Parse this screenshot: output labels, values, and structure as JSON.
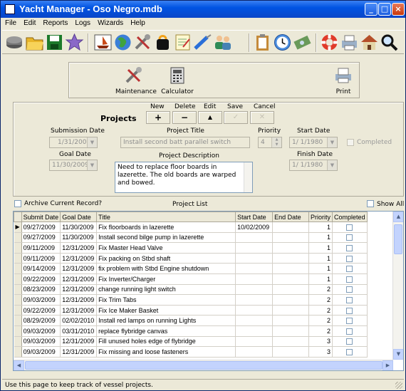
{
  "window": {
    "title": "Yacht Manager - Oso Negro.mdb"
  },
  "menu": [
    "File",
    "Edit",
    "Reports",
    "Logs",
    "Wizards",
    "Help"
  ],
  "toolbar": [
    "disk-icon",
    "folder-icon",
    "save-icon",
    "star-icon",
    "boat-icon",
    "globe-icon",
    "tools-icon",
    "bag-icon",
    "notepad-icon",
    "drill-icon",
    "people-icon",
    "clipboard-icon",
    "clock-icon",
    "money-icon",
    "lifebuoy-icon",
    "printer-icon",
    "house-icon",
    "magnifier-icon"
  ],
  "quick": {
    "maintenance": "Maintenance",
    "calculator": "Calculator",
    "print": "Print"
  },
  "projects": {
    "heading": "Projects",
    "actions": {
      "new": "New",
      "delete": "Delete",
      "edit": "Edit",
      "save": "Save",
      "cancel": "Cancel"
    },
    "submission_date_label": "Submission Date",
    "submission_date": "1/31/2009",
    "goal_date_label": "Goal Date",
    "goal_date": "11/30/2009",
    "project_title_label": "Project Title",
    "project_title": "Install second batt parallel switch",
    "priority_label": "Priority",
    "priority": "4",
    "start_date_label": "Start Date",
    "start_date": "1/  1/1980",
    "completed_label": "Completed",
    "finish_date_label": "Finish Date",
    "finish_date": "1/  1/1980",
    "description_label": "Project Description",
    "description": "Need to replace floor boards in lazerette.  The old boards are warped and bowed."
  },
  "archive_label": "Archive Current Record?",
  "list_label": "Project List",
  "show_all_label": "Show All",
  "columns": [
    "Submit Date",
    "Goal Date",
    "Title",
    "Start Date",
    "End Date",
    "Priority",
    "Completed"
  ],
  "rows": [
    [
      "09/27/2009",
      "11/30/2009",
      "Fix floorboards in lazerette",
      "10/02/2009",
      "",
      "1"
    ],
    [
      "09/27/2009",
      "11/30/2009",
      "Install second bilge pump in lazerette",
      "",
      "",
      "1"
    ],
    [
      "09/11/2009",
      "12/31/2009",
      "Fix Master Head Valve",
      "",
      "",
      "1"
    ],
    [
      "09/11/2009",
      "12/31/2009",
      "Fix packing on Stbd shaft",
      "",
      "",
      "1"
    ],
    [
      "09/14/2009",
      "12/31/2009",
      "fix problem with Stbd Engine shutdown",
      "",
      "",
      "1"
    ],
    [
      "09/22/2009",
      "12/31/2009",
      "Fix Inverter/Charger",
      "",
      "",
      "1"
    ],
    [
      "08/23/2009",
      "12/31/2009",
      "change running light switch",
      "",
      "",
      "2"
    ],
    [
      "09/03/2009",
      "12/31/2009",
      "Fix Trim Tabs",
      "",
      "",
      "2"
    ],
    [
      "09/22/2009",
      "12/31/2009",
      "Fix Ice Maker Basket",
      "",
      "",
      "2"
    ],
    [
      "08/29/2009",
      "02/02/2010",
      "Install red lamps on running Lights",
      "",
      "",
      "2"
    ],
    [
      "09/03/2009",
      "03/31/2010",
      "replace flybridge canvas",
      "",
      "",
      "2"
    ],
    [
      "09/03/2009",
      "12/31/2009",
      "Fill unused holes edge of flybridge",
      "",
      "",
      "3"
    ],
    [
      "09/03/2009",
      "12/31/2009",
      "Fix missing and loose fasteners",
      "",
      "",
      "3"
    ]
  ],
  "status": "Use this page to keep track of vessel projects."
}
